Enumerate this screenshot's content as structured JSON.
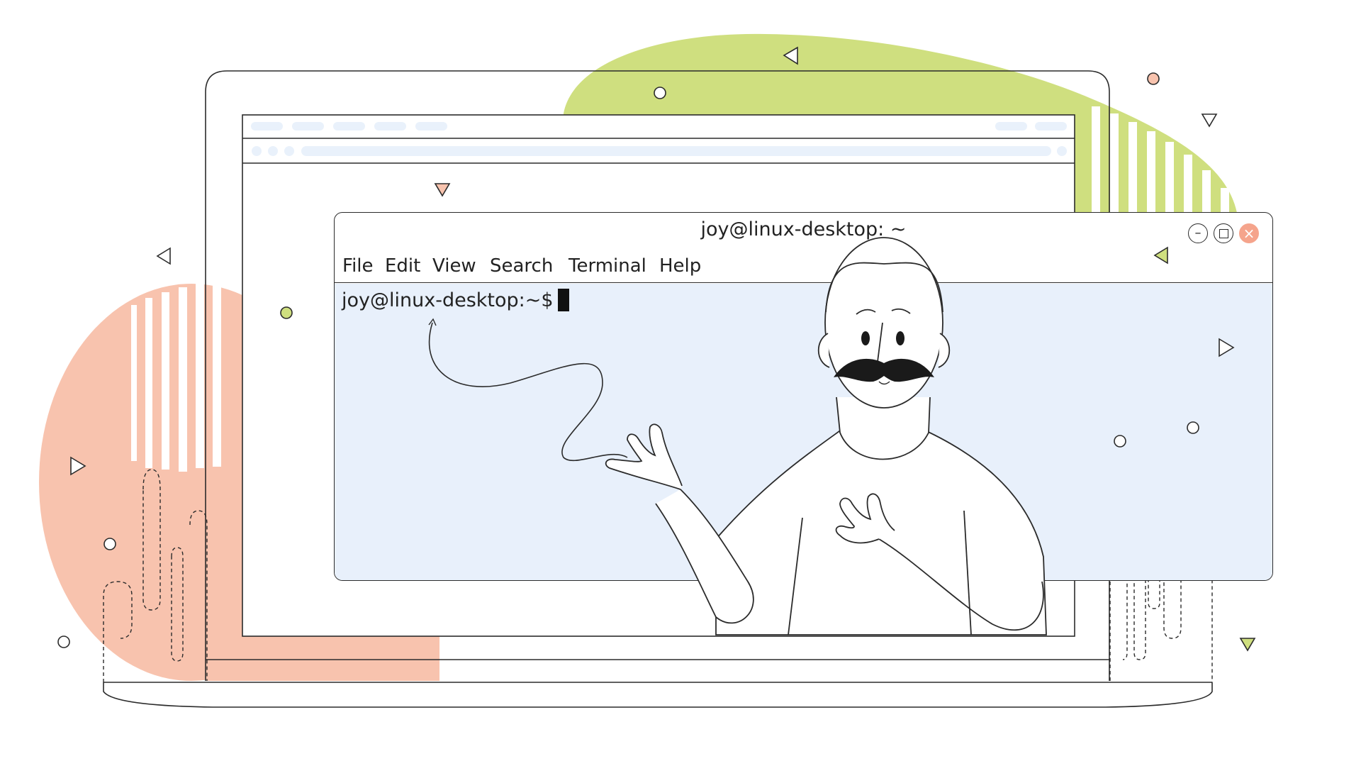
{
  "terminal": {
    "title": "joy@linux-desktop: ~",
    "menu": [
      "File",
      "Edit",
      "View",
      "Search",
      "Terminal",
      "Help"
    ],
    "prompt": "joy@linux-desktop:~$",
    "controls": {
      "minimize_icon": "minimize-icon",
      "maximize_icon": "maximize-icon",
      "close_icon": "close-icon"
    }
  },
  "colors": {
    "accent_green": "#cfdf7f",
    "accent_salmon": "#f8c3ae",
    "terminal_bg": "#e8f0fb",
    "browser_bar": "#e9f1fb"
  }
}
